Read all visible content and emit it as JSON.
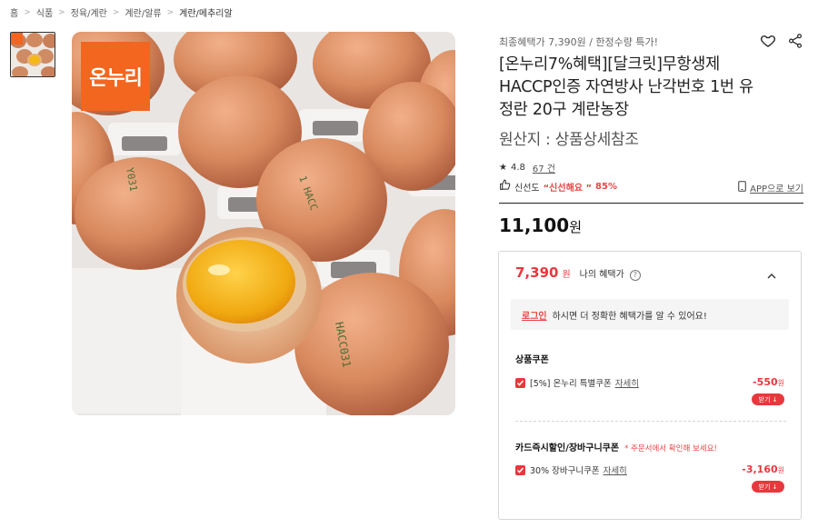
{
  "breadcrumb": [
    "홈",
    "식품",
    "정육/계란",
    "계란/알류",
    "계란/메추리알"
  ],
  "brand_logo_text": "온누리",
  "promo_text": "최종혜택가 7,390원 / 한정수량 특가!",
  "title_lines": [
    "[온누리7%혜택][달크릿]무항생제",
    "HACCP인증 자연방사 난각번호 1번 유",
    "정란 20구 계란농장"
  ],
  "origin": "원산지 : 상품상세참조",
  "rating": {
    "score": "4.8",
    "count": "67 건"
  },
  "freshness": {
    "label": "신선도",
    "tag": "“신선해요 ”",
    "percent": "85%"
  },
  "app_view": "APP으로 보기",
  "price": {
    "amount": "11,100",
    "unit": "원"
  },
  "benefit": {
    "price": "7,390",
    "won": "원",
    "label": "나의 혜택가",
    "help": "?",
    "login_link": "로그인",
    "login_message": "하시면 더 정확한 혜택가를 알 수 있어요!",
    "product_coupon_title": "상품쿠폰",
    "coupon1": {
      "label": "[5%] 온누리 특별쿠폰",
      "detail": "자세히",
      "amount": "-550",
      "won": "원",
      "button": "받기 ↓"
    },
    "card_title": "카드즉시할인/장바구니쿠폰",
    "card_note": "* 주문서에서 확인해 보세요!",
    "coupon2": {
      "label": "30% 장바구니쿠폰",
      "detail": "자세히",
      "amount": "-3,160",
      "won": "원",
      "button": "받기 ↓"
    }
  },
  "colors": {
    "accent": "#e8383d",
    "brand_orange": "#f2661f"
  }
}
